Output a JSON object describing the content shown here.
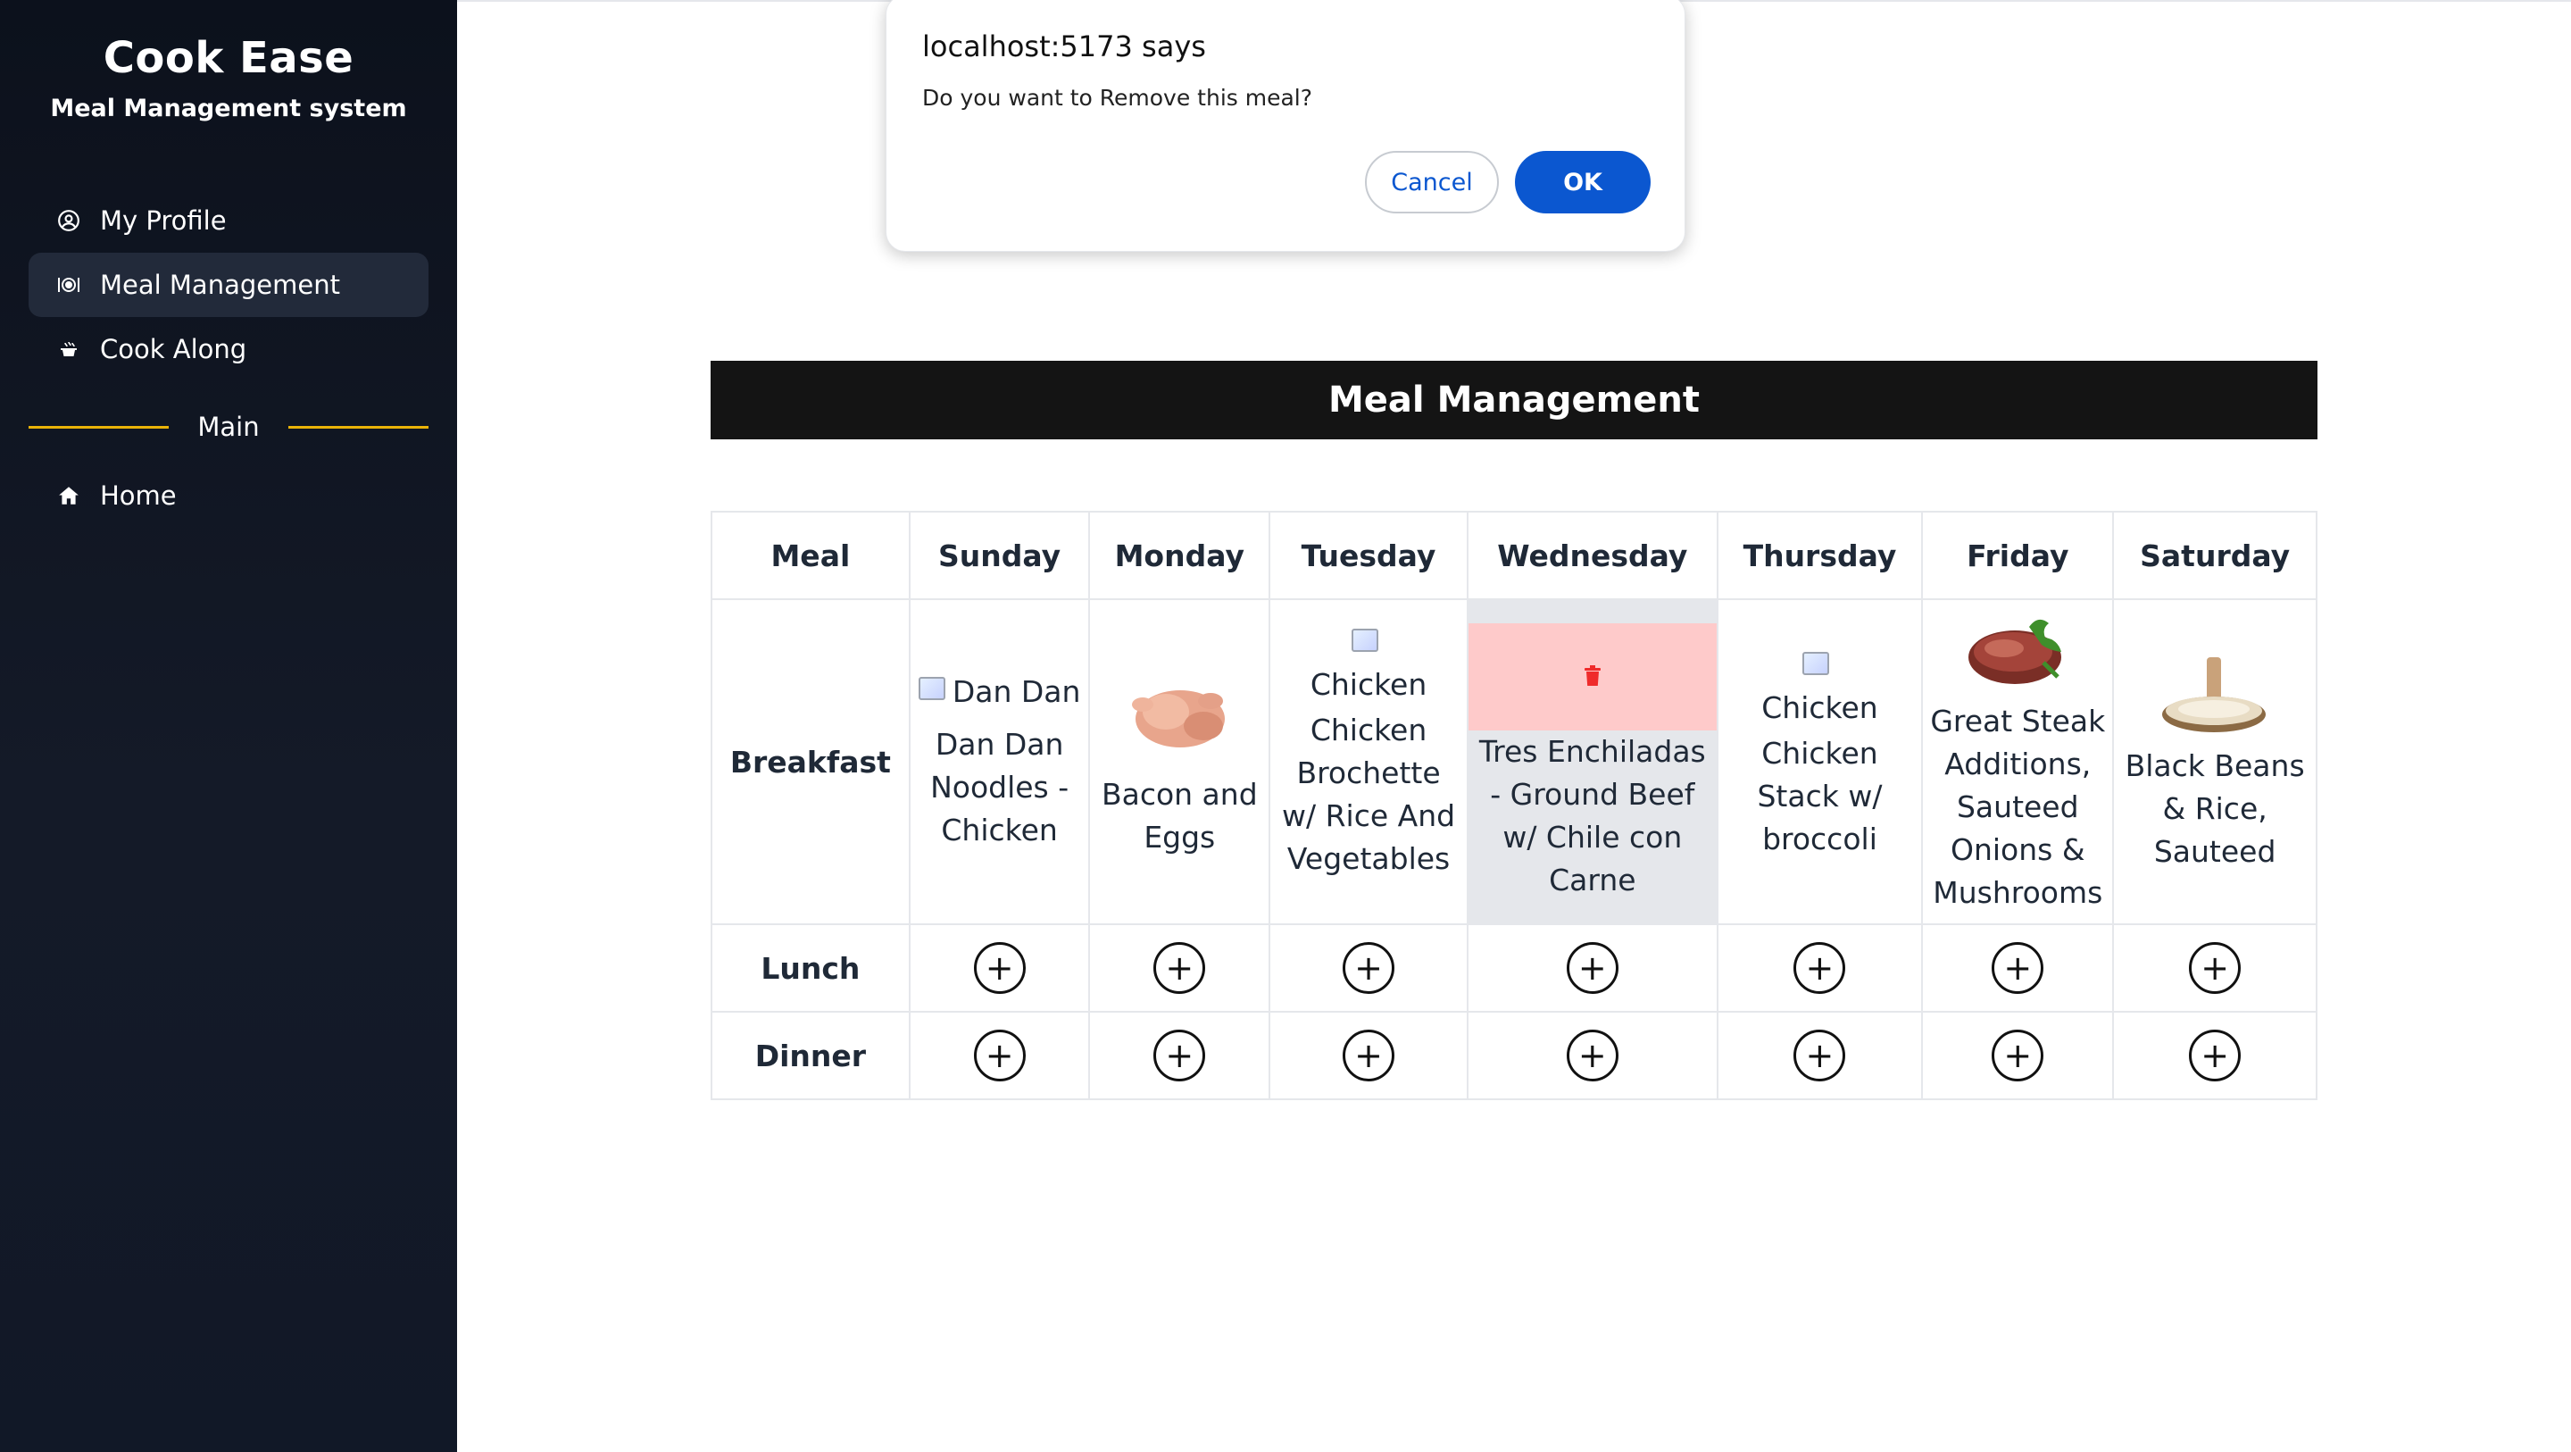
{
  "sidebar": {
    "brand_title": "Cook Ease",
    "brand_subtitle": "Meal Management system",
    "items": [
      {
        "label": "My Profile",
        "icon": "user-circle-icon"
      },
      {
        "label": "Meal Management",
        "icon": "plate-icon",
        "active": true
      },
      {
        "label": "Cook Along",
        "icon": "pot-icon"
      }
    ],
    "section_label": "Main",
    "main_items": [
      {
        "label": "Home",
        "icon": "home-icon"
      }
    ],
    "accent_color": "#eab308"
  },
  "main": {
    "heading": "Meal Management",
    "table": {
      "headers": [
        "Meal",
        "Sunday",
        "Monday",
        "Tuesday",
        "Wednesday",
        "Thursday",
        "Friday",
        "Saturday"
      ],
      "rows": [
        {
          "label": "Breakfast",
          "cells": [
            {
              "img_alt": "Dan Dan",
              "name": "Dan Dan Noodles - Chicken"
            },
            {
              "img": "chicken-photo",
              "name": "Bacon and Eggs"
            },
            {
              "img_alt": "Chicken Brochett",
              "name": "Chicken Brochette w/ Rice And Vegetables"
            },
            {
              "remove_icon": "trash-icon",
              "name": "Tres Enchiladas - Ground Beef w/ Chile con Carne",
              "hovered": true
            },
            {
              "img_alt": "Chicken Stack w/",
              "name": "Chicken Stack w/ broccoli"
            },
            {
              "img": "steak-photo",
              "name": "Great Steak Additions, Sauteed Onions & Mushrooms"
            },
            {
              "img": "rice-bowl-photo",
              "name": "Black Beans & Rice, Sauteed"
            }
          ]
        },
        {
          "label": "Lunch",
          "add_label": "+"
        },
        {
          "label": "Dinner",
          "add_label": "+"
        }
      ]
    }
  },
  "dialog": {
    "title": "localhost:5173 says",
    "message": "Do you want to Remove this meal?",
    "cancel_label": "Cancel",
    "ok_label": "OK",
    "primary_color": "#0b57d0"
  }
}
